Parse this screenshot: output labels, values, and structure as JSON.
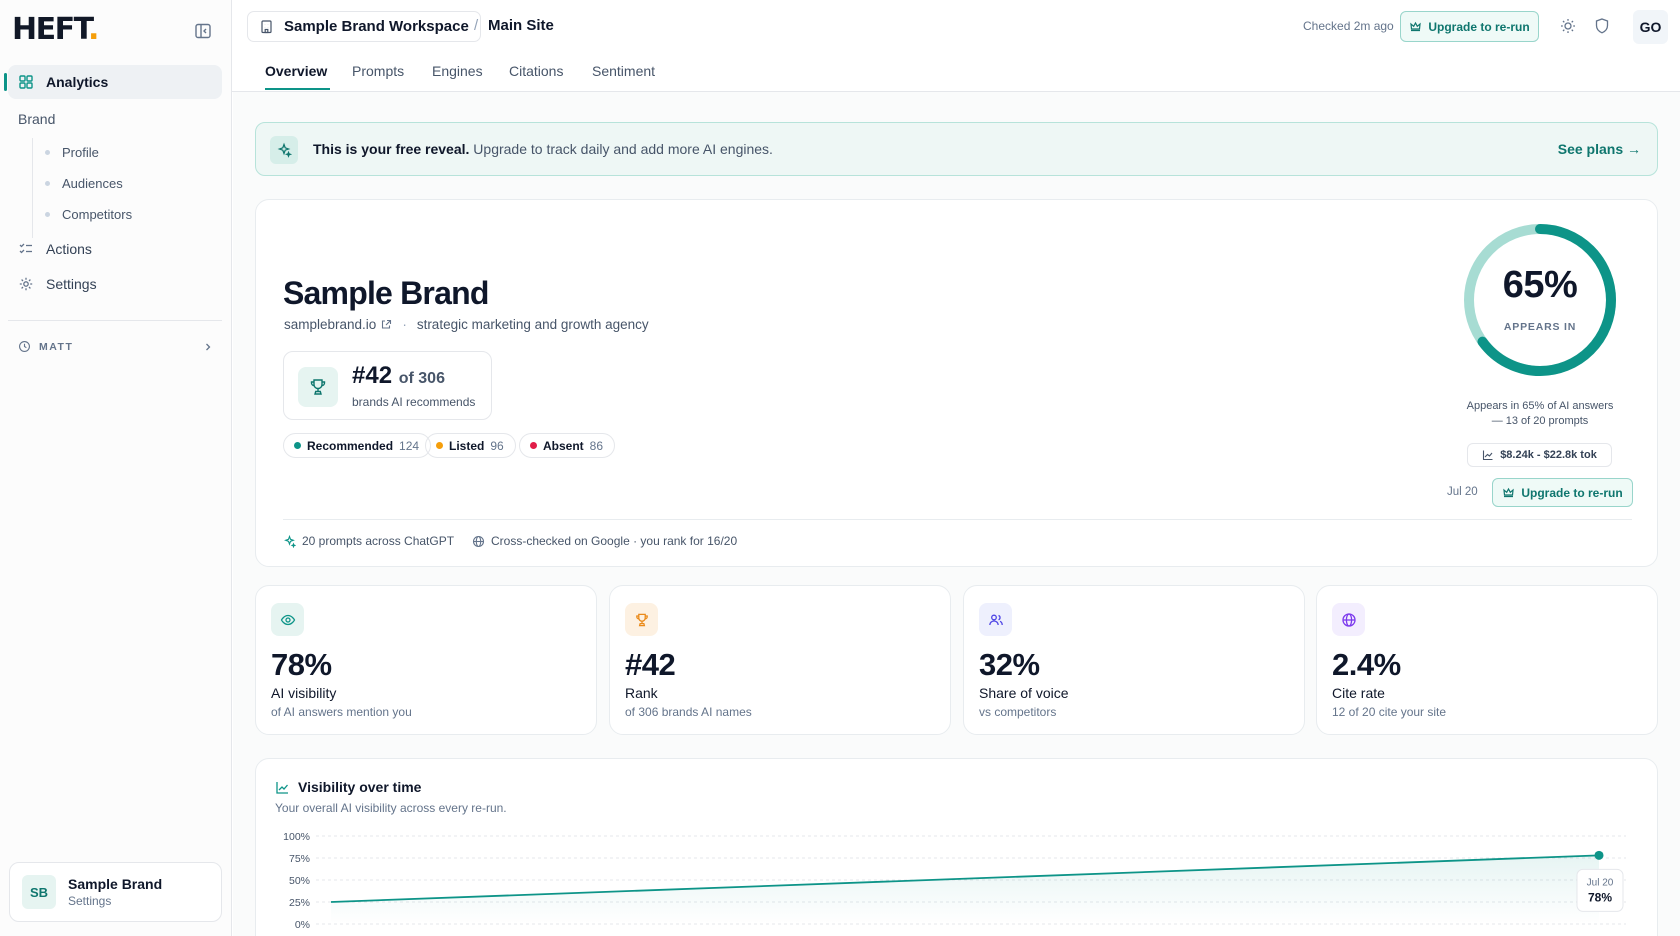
{
  "logo": {
    "text": "HEFT",
    "dot": "."
  },
  "sidebar": {
    "analytics": "Analytics",
    "brand_section": "Brand",
    "brand_items": [
      "Profile",
      "Audiences",
      "Competitors"
    ],
    "actions": "Actions",
    "settings": "Settings",
    "user_label": "MATT",
    "footer": {
      "initials": "SB",
      "name": "Sample Brand",
      "sub": "Settings"
    }
  },
  "header": {
    "workspace": "Sample Brand Workspace",
    "separator": "/",
    "site": "Main Site",
    "checked": "Checked 2m ago",
    "upgrade": "Upgrade to re-run",
    "avatar": "GO"
  },
  "tabs": [
    "Overview",
    "Prompts",
    "Engines",
    "Citations",
    "Sentiment"
  ],
  "banner": {
    "bold": "This is your free reveal.",
    "text": " Upgrade to track daily and add more AI engines.",
    "cta": "See plans →"
  },
  "hero": {
    "brand": "Sample Brand",
    "domain": "samplebrand.io",
    "dot": "·",
    "tagline": "strategic marketing and growth agency",
    "rank": "#42",
    "rank_of": "of 306",
    "rank_sub": "brands AI recommends",
    "pills": [
      {
        "label": "Recommended",
        "count": "124",
        "color": "#0d9488"
      },
      {
        "label": "Listed",
        "count": "96",
        "color": "#f59e0b"
      },
      {
        "label": "Absent",
        "count": "86",
        "color": "#e11d48"
      }
    ],
    "gauge_value": 0.65,
    "gauge_pct": "65%",
    "gauge_label": "APPEARS IN",
    "gauge_desc": "Appears in 65% of AI answers — 13 of 20 prompts",
    "cost": "$8.24k - $22.8k tok",
    "date": "Jul 20",
    "upgrade": "Upgrade to re-run",
    "foot_prompts": "20 prompts across ChatGPT",
    "foot_cross": "Cross-checked on Google · you rank for 16/20"
  },
  "metrics": [
    {
      "value": "78%",
      "name": "AI visibility",
      "desc": "of AI answers mention you",
      "icon": "eye-icon",
      "color": "#0d9488",
      "bg": "#e6f4f1"
    },
    {
      "value": "#42",
      "name": "Rank",
      "desc": "of 306 brands AI names",
      "icon": "trophy-icon",
      "color": "#ea8a1a",
      "bg": "#fdf1e2"
    },
    {
      "value": "32%",
      "name": "Share of voice",
      "desc": "vs competitors",
      "icon": "users-icon",
      "color": "#4f46e5",
      "bg": "#eef0fd"
    },
    {
      "value": "2.4%",
      "name": "Cite rate",
      "desc": "12 of 20 cite your site",
      "icon": "globe-icon",
      "color": "#7c3aed",
      "bg": "#f3eefe"
    }
  ],
  "chart": {
    "title": "Visibility over time",
    "subtitle": "Your overall AI visibility across every re-run."
  },
  "chart_data": {
    "type": "line",
    "title": "Visibility over time",
    "y_ticks": [
      "100%",
      "75%",
      "50%",
      "25%",
      "0%"
    ],
    "ylim": [
      0,
      100
    ],
    "series": [
      {
        "values": [
          25,
          78
        ]
      }
    ],
    "tooltip": {
      "date": "Jul 20",
      "value": "78%"
    },
    "grid": true,
    "color": "#0d9488"
  }
}
